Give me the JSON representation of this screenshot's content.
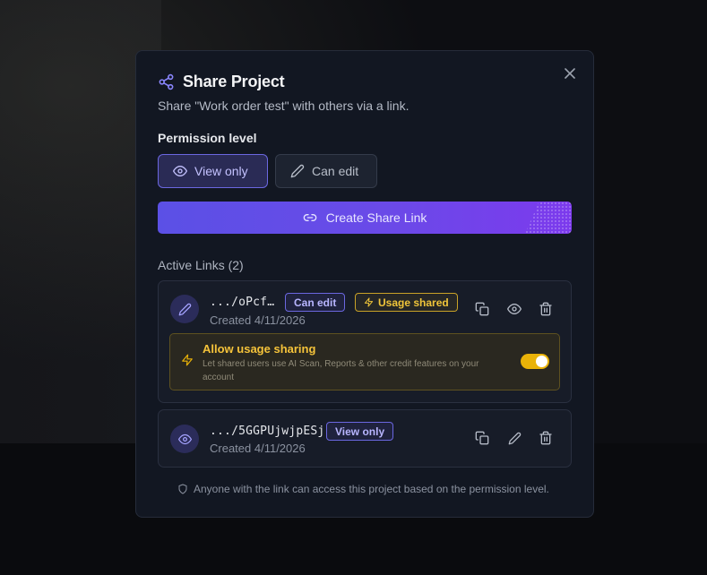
{
  "dialog": {
    "title": "Share Project",
    "subtitle": "Share \"Work order test\" with others via a link.",
    "permission_label": "Permission level",
    "permissions": [
      {
        "label": "View only",
        "selected": true
      },
      {
        "label": "Can edit",
        "selected": false
      }
    ],
    "create_button": "Create Share Link",
    "active_links_label": "Active Links (2)",
    "footer_note": "Anyone with the link can access this project based on the permission level."
  },
  "links": [
    {
      "url": ".../oPcf…",
      "created": "Created 4/11/2026",
      "permission_badge": "Can edit",
      "usage_badge": "Usage shared",
      "usage_sharing": {
        "title": "Allow usage sharing",
        "description": "Let shared users use AI Scan, Reports & other credit features on your account",
        "enabled": true
      }
    },
    {
      "url": ".../5GGPUjwjpESj",
      "created": "Created 4/11/2026",
      "permission_badge": "View only"
    }
  ],
  "colors": {
    "accent": "#6b67e0",
    "usage": "#eab308",
    "modal_bg": "#121722"
  }
}
